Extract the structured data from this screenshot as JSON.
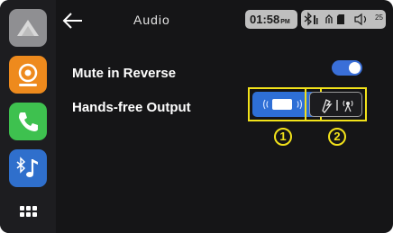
{
  "header": {
    "title": "Audio",
    "time": "01:58",
    "time_suffix": "PM",
    "volume_level": "25"
  },
  "sidebar": {
    "items": [
      {
        "name": "home",
        "icon": "home-icon"
      },
      {
        "name": "radio",
        "icon": "radio-icon",
        "color": "#ee8a1d"
      },
      {
        "name": "phone",
        "icon": "phone-icon",
        "color": "#3ec14f"
      },
      {
        "name": "bluetooth-music",
        "icon": "bluetooth-music-icon",
        "color": "#2f6fcc"
      },
      {
        "name": "apps",
        "icon": "app-grid-icon"
      }
    ]
  },
  "settings": {
    "mute_in_reverse": {
      "label": "Mute in Reverse",
      "enabled": true
    },
    "hands_free_output": {
      "label": "Hands-free Output",
      "options": [
        {
          "callout": "1",
          "icon": "speaker-output-icon",
          "selected": true
        },
        {
          "callout": "2",
          "icon": "phone-antenna-output-icon",
          "selected": false
        }
      ]
    }
  },
  "colors": {
    "accent": "#2e6fd6",
    "highlight": "#f2e21a",
    "background": "#151517"
  }
}
